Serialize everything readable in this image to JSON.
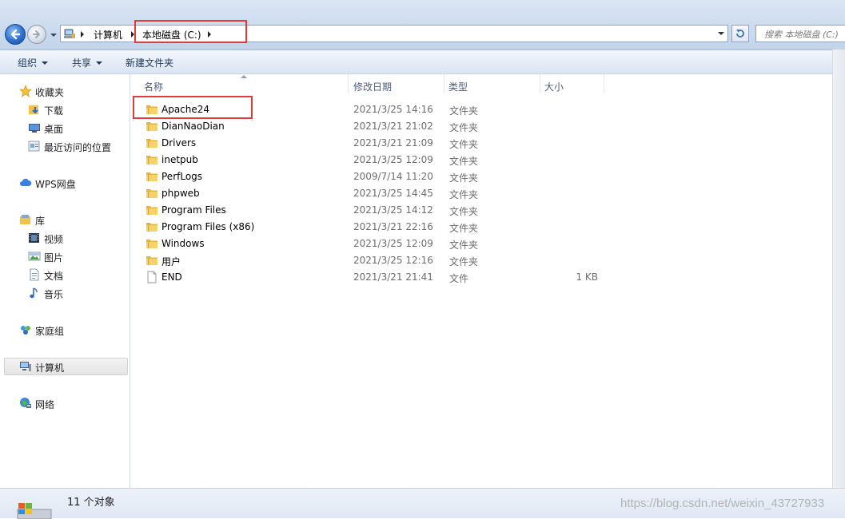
{
  "breadcrumb": {
    "items": [
      "计算机",
      "本地磁盘 (C:)"
    ]
  },
  "search": {
    "placeholder": "搜索 本地磁盘 (C:)"
  },
  "toolbar": {
    "organize": "组织",
    "share": "共享",
    "new_folder": "新建文件夹"
  },
  "sidebar": {
    "favorites": {
      "label": "收藏夹",
      "icon": "star-icon"
    },
    "favorites_items": [
      {
        "label": "下载",
        "icon": "download-folder-icon"
      },
      {
        "label": "桌面",
        "icon": "desktop-icon"
      },
      {
        "label": "最近访问的位置",
        "icon": "recent-places-icon"
      }
    ],
    "wps": {
      "label": "WPS网盘",
      "icon": "cloud-icon"
    },
    "library": {
      "label": "库",
      "icon": "library-icon"
    },
    "library_items": [
      {
        "label": "视频",
        "icon": "video-icon"
      },
      {
        "label": "图片",
        "icon": "picture-icon"
      },
      {
        "label": "文档",
        "icon": "document-icon"
      },
      {
        "label": "音乐",
        "icon": "music-icon"
      }
    ],
    "homegroup": {
      "label": "家庭组",
      "icon": "homegroup-icon"
    },
    "computer": {
      "label": "计算机",
      "icon": "computer-icon",
      "selected": true
    },
    "network": {
      "label": "网络",
      "icon": "network-icon"
    }
  },
  "columns": {
    "name": "名称",
    "modified": "修改日期",
    "type": "类型",
    "size": "大小"
  },
  "files": [
    {
      "name": "Apache24",
      "modified": "2021/3/25 14:16",
      "type": "文件夹",
      "size": "",
      "icon": "folder-icon"
    },
    {
      "name": "DianNaoDian",
      "modified": "2021/3/21 21:02",
      "type": "文件夹",
      "size": "",
      "icon": "folder-icon"
    },
    {
      "name": "Drivers",
      "modified": "2021/3/21 21:09",
      "type": "文件夹",
      "size": "",
      "icon": "folder-icon"
    },
    {
      "name": "inetpub",
      "modified": "2021/3/25 12:09",
      "type": "文件夹",
      "size": "",
      "icon": "folder-icon"
    },
    {
      "name": "PerfLogs",
      "modified": "2009/7/14 11:20",
      "type": "文件夹",
      "size": "",
      "icon": "folder-icon"
    },
    {
      "name": "phpweb",
      "modified": "2021/3/25 14:45",
      "type": "文件夹",
      "size": "",
      "icon": "folder-icon"
    },
    {
      "name": "Program Files",
      "modified": "2021/3/25 14:12",
      "type": "文件夹",
      "size": "",
      "icon": "folder-icon"
    },
    {
      "name": "Program Files (x86)",
      "modified": "2021/3/21 22:16",
      "type": "文件夹",
      "size": "",
      "icon": "folder-icon"
    },
    {
      "name": "Windows",
      "modified": "2021/3/25 12:09",
      "type": "文件夹",
      "size": "",
      "icon": "folder-icon"
    },
    {
      "name": "用户",
      "modified": "2021/3/25 12:16",
      "type": "文件夹",
      "size": "",
      "icon": "folder-icon"
    },
    {
      "name": "END",
      "modified": "2021/3/21 21:41",
      "type": "文件",
      "size": "1 KB",
      "icon": "file-icon"
    }
  ],
  "status": {
    "count_text": "11 个对象"
  },
  "watermark": "https://blog.csdn.net/weixin_43727933",
  "colors": {
    "highlight": "#e33a3a",
    "folder": "#f1c24b",
    "header_text": "#4c607a"
  }
}
